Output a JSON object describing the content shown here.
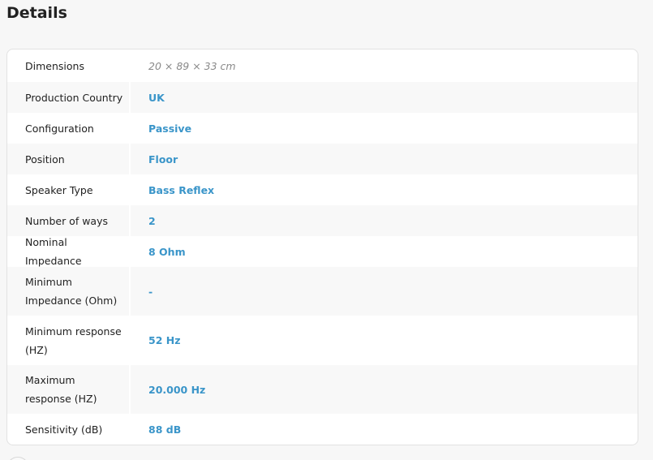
{
  "details": {
    "title": "Details",
    "rows": [
      {
        "label": "Dimensions",
        "value": "20 × 89 × 33 cm"
      },
      {
        "label": "Production Country",
        "value": "UK"
      },
      {
        "label": "Configuration",
        "value": "Passive"
      },
      {
        "label": "Position",
        "value": "Floor"
      },
      {
        "label": "Speaker Type",
        "value": "Bass Reflex"
      },
      {
        "label": "Number of ways",
        "value": "2"
      },
      {
        "label": "Nominal Impedance",
        "value": "8 Ohm"
      },
      {
        "label": "Minimum Impedance (Ohm)",
        "value": "-"
      },
      {
        "label": "Minimum response (HZ)",
        "value": "52 Hz"
      },
      {
        "label": "Maximum response (HZ)",
        "value": "20.000 Hz"
      },
      {
        "label": "Sensitivity (dB)",
        "value": "88 dB"
      }
    ]
  },
  "colors": {
    "value_link": "#3a95c9",
    "row_alt": "#f8f8f8",
    "text": "#222222"
  }
}
